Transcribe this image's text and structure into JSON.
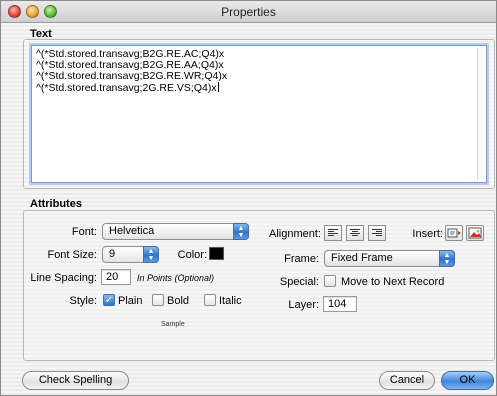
{
  "window": {
    "title": "Properties"
  },
  "text_section": {
    "label": "Text",
    "lines": [
      "^(*Std.stored.transavg;B2G.RE.AC;Q4)x",
      "^(*Std.stored.transavg;B2G.RE.AA;Q4)x",
      "^(*Std.stored.transavg;B2G.RE.WR;Q4)x",
      "^(*Std.stored.transavg;2G.RE.VS;Q4)x"
    ]
  },
  "attributes": {
    "label": "Attributes",
    "font_label": "Font:",
    "font_value": "Helvetica",
    "font_size_label": "Font Size:",
    "font_size_value": "9",
    "color_label": "Color:",
    "color_value": "#000000",
    "line_spacing_label": "Line Spacing:",
    "line_spacing_value": "20",
    "line_spacing_note": "In Points (Optional)",
    "style_label": "Style:",
    "style_plain": "Plain",
    "style_bold": "Bold",
    "style_italic": "Italic",
    "style_plain_checked": true,
    "style_bold_checked": false,
    "style_italic_checked": false,
    "sample_text": "Sample",
    "alignment_label": "Alignment:",
    "insert_label": "Insert:",
    "frame_label": "Frame:",
    "frame_value": "Fixed Frame",
    "special_label": "Special:",
    "special_option": "Move to Next Record",
    "special_checked": false,
    "layer_label": "Layer:",
    "layer_value": "104"
  },
  "buttons": {
    "check_spelling": "Check Spelling",
    "cancel": "Cancel",
    "ok": "OK"
  },
  "colors": {
    "accent": "#3d86d9",
    "focus_ring": "#b7cdf0"
  }
}
